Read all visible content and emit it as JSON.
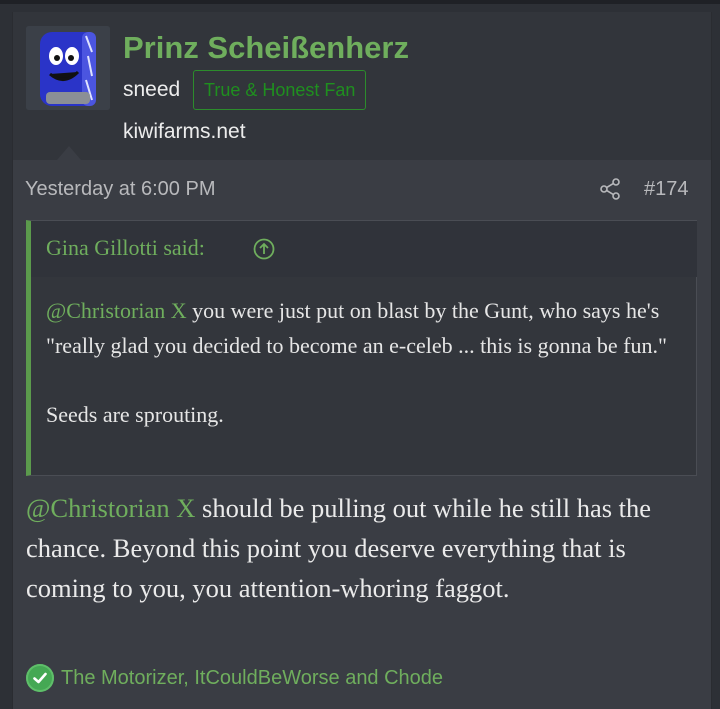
{
  "post": {
    "author": {
      "name": "Prinz Scheißenherz",
      "title": "sneed",
      "badge": "True & Honest Fan",
      "site": "kiwifarms.net"
    },
    "timestamp": "Yesterday at 6:00 PM",
    "post_number": "#174",
    "quote": {
      "author_label": "Gina Gillotti said:",
      "mention": "@Christorian X",
      "text_line1_rest": " you were just put on blast by the Gunt, who says he's \"really glad you decided to become an e-celeb ... this is gonna be fun.\"",
      "text_line2": "Seeds are sprouting."
    },
    "body": {
      "mention": "@Christorian X",
      "text": " should be pulling out while he still has the chance. Beyond this point you deserve everything that is coming to you, you attention-whoring faggot."
    },
    "reactions": {
      "icon": "check-icon",
      "names": "The Motorizer, ItCouldBeWorse and Chode"
    }
  },
  "colors": {
    "accent_green": "#6fae5d",
    "badge_green": "#1f8f1f",
    "background": "#2d3036",
    "post_bg": "#3a3d44"
  }
}
